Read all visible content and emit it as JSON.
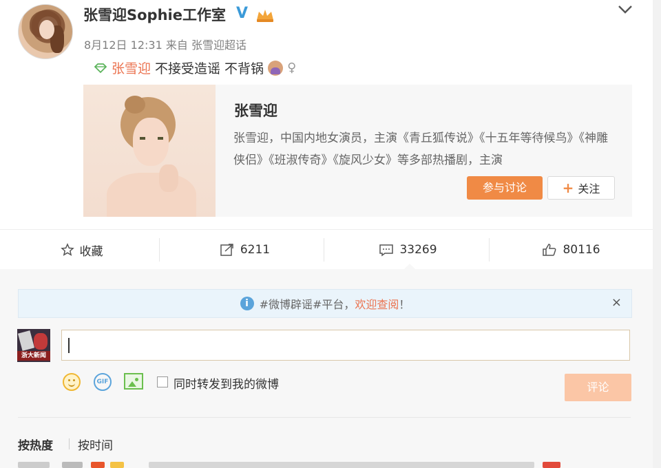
{
  "post": {
    "username": "张雪迎Sophie工作室",
    "verified_icon": "verified-v-icon",
    "crown_icon": "member-crown-icon",
    "date": "8月12日",
    "time": "12:31",
    "source_prefix": "来自",
    "source": "张雪迎超话",
    "mention": "张雪迎",
    "text": "不接受造谣 不背锅",
    "gender_symbol": "♀"
  },
  "profile_card": {
    "name": "张雪迎",
    "description": "张雪迎，中国内地女演员，主演《青丘狐传说》《十五年等待候鸟》《神雕侠侣》《班淑传奇》《旋风少女》等多部热播剧，主演",
    "discuss_label": "参与讨论",
    "follow_label": "关注"
  },
  "actions": {
    "favorite_label": "收藏",
    "repost_count": "6211",
    "comment_count": "33269",
    "like_count": "80116"
  },
  "comment_box": {
    "notice_prefix": "#微博辟谣#平台，",
    "notice_link": "欢迎查阅",
    "notice_suffix": "！",
    "close_symbol": "×",
    "input_value": "",
    "avatar_caption": "浙大新闻",
    "gif_label": "GIF",
    "repost_checkbox_label": "同时转发到我的微博",
    "submit_label": "评论"
  },
  "sort_tabs": {
    "hot": "按热度",
    "time": "按时间"
  },
  "colors": {
    "accent_orange": "#eb7350",
    "button_orange": "#f08a45",
    "submit_disabled": "#fbc6a6",
    "verified_blue": "#3b9ad8",
    "notice_bg": "#eaf4fb"
  }
}
